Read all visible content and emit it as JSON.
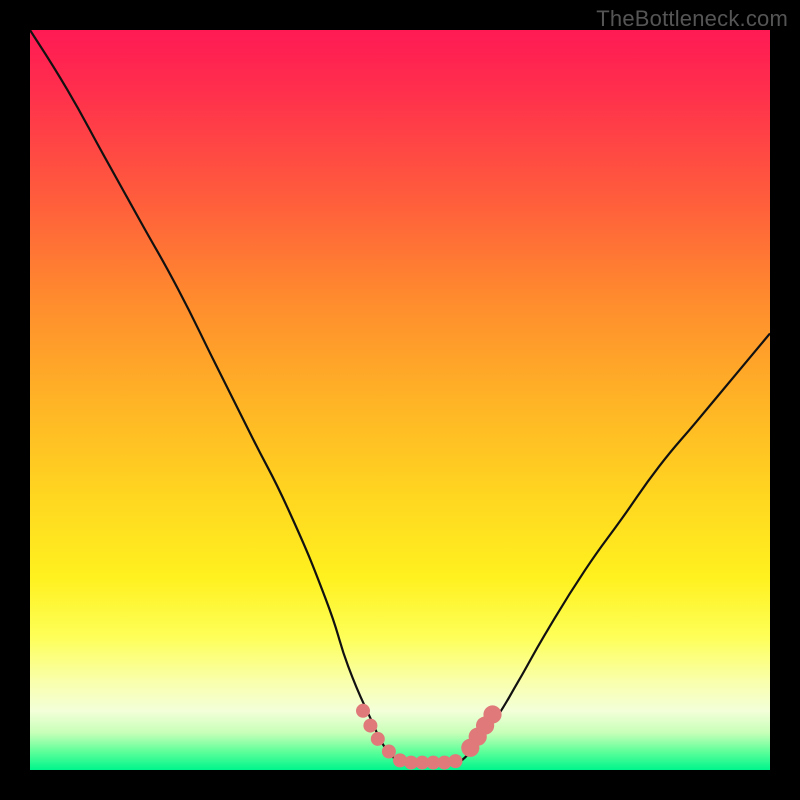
{
  "attribution": "TheBottleneck.com",
  "chart_data": {
    "type": "line",
    "title": "",
    "xlabel": "",
    "ylabel": "",
    "xlim": [
      0,
      100
    ],
    "ylim": [
      0,
      100
    ],
    "left_curve": {
      "x": [
        0,
        5,
        10,
        15,
        20,
        25,
        30,
        35,
        40,
        43,
        46,
        48,
        50
      ],
      "y": [
        100,
        92,
        83,
        74,
        65,
        55,
        45,
        35,
        23,
        14,
        7,
        3,
        1
      ]
    },
    "right_curve": {
      "x": [
        58,
        60,
        63,
        66,
        70,
        75,
        80,
        85,
        90,
        95,
        100
      ],
      "y": [
        1,
        3,
        7,
        12,
        19,
        27,
        34,
        41,
        47,
        53,
        59
      ]
    },
    "flat_segment": {
      "x": [
        50,
        58
      ],
      "y": [
        1,
        1
      ]
    },
    "markers": {
      "color": "#e07a7a",
      "points": [
        {
          "x": 45.0,
          "y": 8.0,
          "r": 1.0
        },
        {
          "x": 46.0,
          "y": 6.0,
          "r": 1.0
        },
        {
          "x": 47.0,
          "y": 4.2,
          "r": 1.0
        },
        {
          "x": 48.5,
          "y": 2.5,
          "r": 1.0
        },
        {
          "x": 50.0,
          "y": 1.3,
          "r": 1.0
        },
        {
          "x": 51.5,
          "y": 1.0,
          "r": 1.0
        },
        {
          "x": 53.0,
          "y": 1.0,
          "r": 1.0
        },
        {
          "x": 54.5,
          "y": 1.0,
          "r": 1.0
        },
        {
          "x": 56.0,
          "y": 1.0,
          "r": 1.0
        },
        {
          "x": 57.5,
          "y": 1.2,
          "r": 1.0
        },
        {
          "x": 59.5,
          "y": 3.0,
          "r": 1.3
        },
        {
          "x": 60.5,
          "y": 4.5,
          "r": 1.3
        },
        {
          "x": 61.5,
          "y": 6.0,
          "r": 1.3
        },
        {
          "x": 62.5,
          "y": 7.5,
          "r": 1.3
        }
      ]
    },
    "gradient_stops": [
      {
        "pos": 0.0,
        "color": "#ff1a54"
      },
      {
        "pos": 0.5,
        "color": "#ffb326"
      },
      {
        "pos": 0.82,
        "color": "#feff58"
      },
      {
        "pos": 1.0,
        "color": "#00f58c"
      }
    ]
  }
}
